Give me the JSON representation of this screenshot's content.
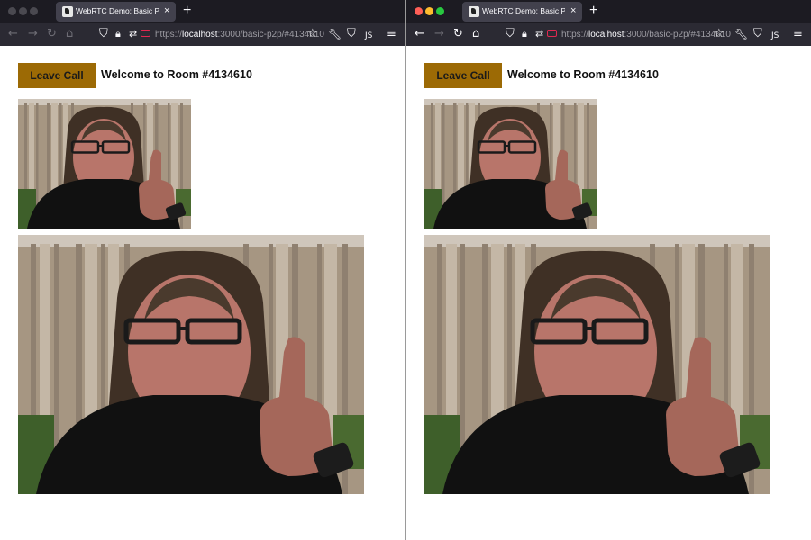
{
  "windows": [
    {
      "side": "left",
      "tab_title": "WebRTC Demo: Basic Peer-to-",
      "url_scheme": "https://",
      "url_host": "localhost",
      "url_path": ":3000/basic-p2p/#4134610",
      "leave_label": "Leave Call",
      "room_title": "Welcome to Room #4134610"
    },
    {
      "side": "right",
      "tab_title": "WebRTC Demo: Basic Peer-to-",
      "url_scheme": "https://",
      "url_host": "localhost",
      "url_path": ":3000/basic-p2p/#4134610",
      "leave_label": "Leave Call",
      "room_title": "Welcome to Room #4134610"
    }
  ],
  "icons": {
    "tab_close": "×",
    "new_tab": "+",
    "back": "←",
    "forward": "→",
    "reload": "↻",
    "home": "⌂",
    "shield": "⛉",
    "bookmark": "☆",
    "menu": "≡"
  },
  "colors": {
    "leave_button": "#9c6a05",
    "browser_chrome": "#2b2a33",
    "tab_bar": "#1c1b22"
  }
}
